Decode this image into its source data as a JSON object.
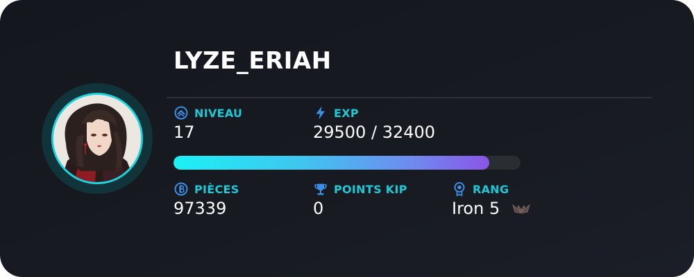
{
  "profile": {
    "username": "LYZE_ERIAH"
  },
  "stats": {
    "niveau": {
      "label": "NIVEAU",
      "value": "17",
      "icon": "chevron-up-circle-icon"
    },
    "exp": {
      "label": "EXP",
      "value": "29500 / 32400",
      "icon": "lightning-icon"
    },
    "pieces": {
      "label": "PIÈCES",
      "value": "97339",
      "icon": "coin-icon"
    },
    "points_kip": {
      "label": "POINTS KIP",
      "value": "0",
      "icon": "trophy-icon"
    },
    "rang": {
      "label": "RANG",
      "value": "Iron 5",
      "icon": "rank-badge-icon",
      "emblem": "iron-rank-emblem-icon"
    }
  },
  "progress": {
    "current": 29500,
    "max": 32400,
    "fraction": 0.9105
  },
  "colors": {
    "accent": "#1cc9d6",
    "avatar_ring": "#1ad4de",
    "background": "#171a21",
    "track": "#2a2d32",
    "fill_start": "#1bf1f5",
    "fill_end": "#8a55e6"
  }
}
